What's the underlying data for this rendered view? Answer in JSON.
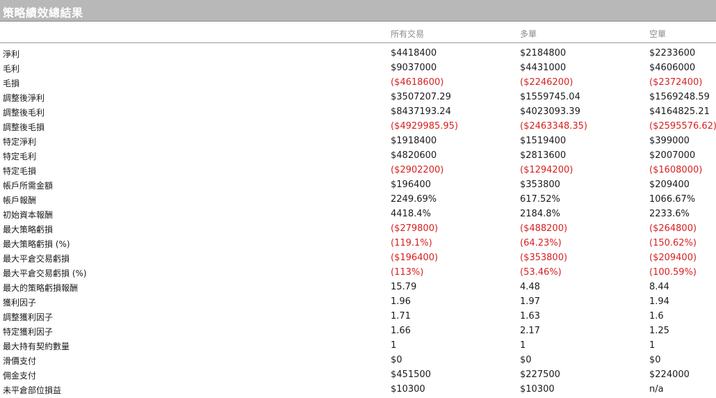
{
  "title": "策略績效總結果",
  "columns": [
    "所有交易",
    "多單",
    "空單"
  ],
  "rows": [
    {
      "label": "淨利",
      "values": [
        "$4418400",
        "$2184800",
        "$2233600"
      ],
      "neg": [
        false,
        false,
        false
      ]
    },
    {
      "label": "毛利",
      "values": [
        "$9037000",
        "$4431000",
        "$4606000"
      ],
      "neg": [
        false,
        false,
        false
      ]
    },
    {
      "label": "毛損",
      "values": [
        "($4618600)",
        "($2246200)",
        "($2372400)"
      ],
      "neg": [
        true,
        true,
        true
      ]
    },
    {
      "label": "調整後淨利",
      "values": [
        "$3507207.29",
        "$1559745.04",
        "$1569248.59"
      ],
      "neg": [
        false,
        false,
        false
      ]
    },
    {
      "label": "調整後毛利",
      "values": [
        "$8437193.24",
        "$4023093.39",
        "$4164825.21"
      ],
      "neg": [
        false,
        false,
        false
      ]
    },
    {
      "label": "調整後毛損",
      "values": [
        "($4929985.95)",
        "($2463348.35)",
        "($2595576.62)"
      ],
      "neg": [
        true,
        true,
        true
      ]
    },
    {
      "label": "特定淨利",
      "values": [
        "$1918400",
        "$1519400",
        "$399000"
      ],
      "neg": [
        false,
        false,
        false
      ]
    },
    {
      "label": "特定毛利",
      "values": [
        "$4820600",
        "$2813600",
        "$2007000"
      ],
      "neg": [
        false,
        false,
        false
      ]
    },
    {
      "label": "特定毛損",
      "values": [
        "($2902200)",
        "($1294200)",
        "($1608000)"
      ],
      "neg": [
        true,
        true,
        true
      ]
    },
    {
      "label": "帳戶所需金額",
      "values": [
        "$196400",
        "$353800",
        "$209400"
      ],
      "neg": [
        false,
        false,
        false
      ]
    },
    {
      "label": "帳戶報酬",
      "values": [
        "2249.69%",
        "617.52%",
        "1066.67%"
      ],
      "neg": [
        false,
        false,
        false
      ]
    },
    {
      "label": "初始資本報酬",
      "values": [
        "4418.4%",
        "2184.8%",
        "2233.6%"
      ],
      "neg": [
        false,
        false,
        false
      ]
    },
    {
      "label": "最大策略虧損",
      "values": [
        "($279800)",
        "($488200)",
        "($264800)"
      ],
      "neg": [
        true,
        true,
        true
      ]
    },
    {
      "label": "最大策略虧損 (%)",
      "values": [
        "(119.1%)",
        "(64.23%)",
        "(150.62%)"
      ],
      "neg": [
        true,
        true,
        true
      ]
    },
    {
      "label": "最大平倉交易虧損",
      "values": [
        "($196400)",
        "($353800)",
        "($209400)"
      ],
      "neg": [
        true,
        true,
        true
      ]
    },
    {
      "label": "最大平倉交易虧損 (%)",
      "values": [
        "(113%)",
        "(53.46%)",
        "(100.59%)"
      ],
      "neg": [
        true,
        true,
        true
      ]
    },
    {
      "label": "最大的策略虧損報酬",
      "values": [
        "15.79",
        "4.48",
        "8.44"
      ],
      "neg": [
        false,
        false,
        false
      ]
    },
    {
      "label": "獲利因子",
      "values": [
        "1.96",
        "1.97",
        "1.94"
      ],
      "neg": [
        false,
        false,
        false
      ]
    },
    {
      "label": "調整獲利因子",
      "values": [
        "1.71",
        "1.63",
        "1.6"
      ],
      "neg": [
        false,
        false,
        false
      ]
    },
    {
      "label": "特定獲利因子",
      "values": [
        "1.66",
        "2.17",
        "1.25"
      ],
      "neg": [
        false,
        false,
        false
      ]
    },
    {
      "label": "最大持有契約數量",
      "values": [
        "1",
        "1",
        "1"
      ],
      "neg": [
        false,
        false,
        false
      ]
    },
    {
      "label": "滑價支付",
      "values": [
        "$0",
        "$0",
        "$0"
      ],
      "neg": [
        false,
        false,
        false
      ]
    },
    {
      "label": "佣金支付",
      "values": [
        "$451500",
        "$227500",
        "$224000"
      ],
      "neg": [
        false,
        false,
        false
      ]
    },
    {
      "label": "未平倉部位損益",
      "values": [
        "$10300",
        "$10300",
        "n/a"
      ],
      "neg": [
        false,
        false,
        false
      ]
    }
  ]
}
